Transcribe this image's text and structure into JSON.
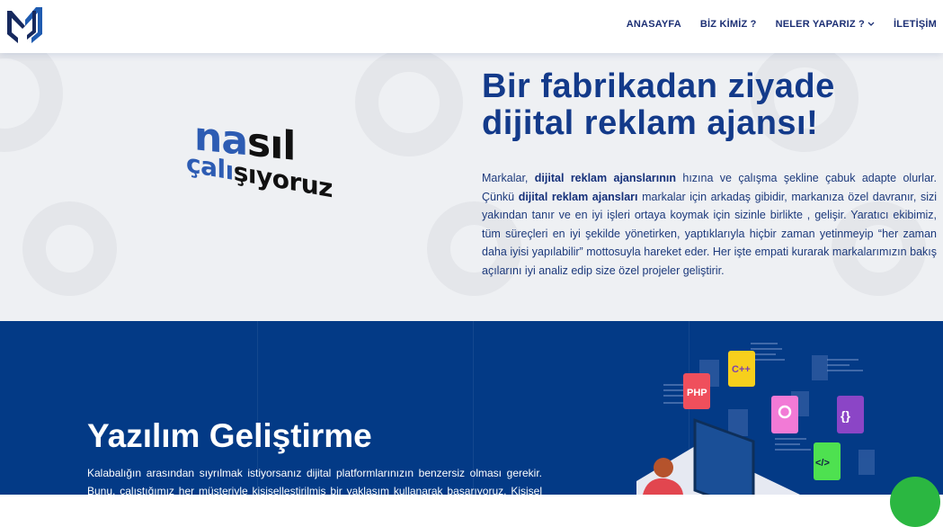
{
  "header": {
    "logo": "M",
    "nav": [
      {
        "label": "ANASAYFA"
      },
      {
        "label": "BİZ KİMİZ ?"
      },
      {
        "label": "NELER YAPARIZ ?",
        "has_dropdown": true
      },
      {
        "label": "İLETİŞİM"
      }
    ]
  },
  "hero": {
    "graphic": {
      "line1_blue": "na",
      "line1_black": "sıl",
      "line2_blue": "çalı",
      "line2_black": "şıyoruz"
    },
    "title_line1": "Bir fabrikadan ziyade",
    "title_line2": "dijital reklam ajansı!",
    "p": {
      "t1": "Markalar, ",
      "b1": "dijital reklam ajanslarının",
      "t2": " hızına ve çalışma şekline çabuk adapte olurlar. Çünkü ",
      "b2": "dijital reklam ajansları",
      "t3": " markalar için arkadaş gibidir, markanıza özel davranır, sizi yakından tanır ve en iyi işleri ortaya koymak için sizinle birlikte , gelişir. Yaratıcı ekibimiz, tüm süreçleri en iyi şekilde yönetirken, yaptıklarıyla hiçbir zaman yetinmeyip “her zaman daha iyisi yapılabilir” mottosuyla hareket eder. Her işte empati kurarak markalarımızın bakış açılarını iyi analiz edip size özel projeler geliştirir."
    }
  },
  "software": {
    "title": "Yazılım Geliştirme",
    "text": "Kalabalığın arasından sıyrılmak istiyorsanız dijital platformlarınızın benzersiz olması gerekir. Bunu, çalıştığımız her müşteriyle kişiselleştirilmiş bir yaklaşım kullanarak başarıyoruz. Kişisel istek ve",
    "illustration_labels": {
      "php": "PHP",
      "cpp": "C++",
      "braces": "{}",
      "tag": "</>"
    }
  },
  "colors": {
    "brand": "#133a8a",
    "section_bg": "#033a86",
    "whatsapp": "#2bb741"
  }
}
